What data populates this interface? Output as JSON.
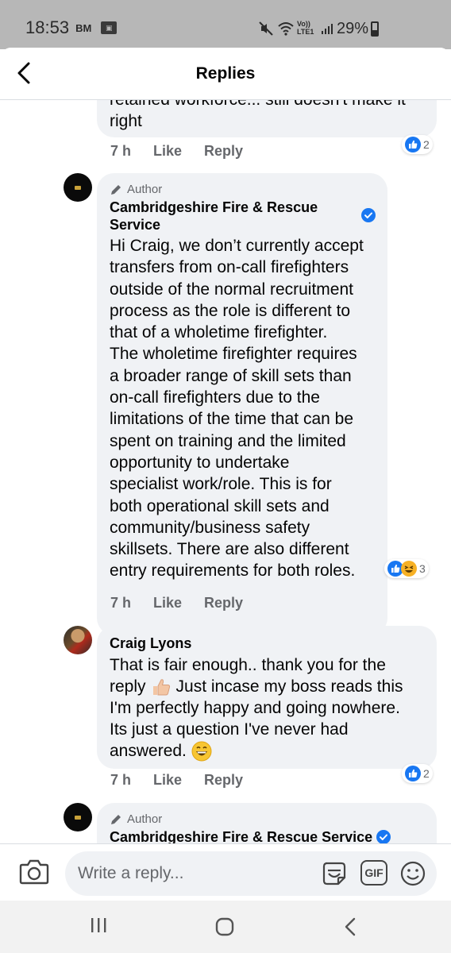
{
  "status_bar": {
    "time": "18:53",
    "carrier_badge": "BM",
    "volte": "Vo)) LTE1",
    "battery": "29%"
  },
  "header": {
    "title": "Replies"
  },
  "comments": [
    {
      "partial_text_top": "retained workforce... still doesn't make it",
      "partial_text_bottom": "right",
      "time": "7 h",
      "like": "Like",
      "reply": "Reply",
      "reaction_count": "2",
      "reactions": [
        "like-icon"
      ]
    },
    {
      "author_tag": "Author",
      "name": "Cambridgeshire Fire & Rescue\nService",
      "verified": true,
      "text": "Hi Craig, we don’t currently accept\ntransfers from on-call firefighters\noutside of the normal recruitment\nprocess as the role is different to\nthat of a wholetime firefighter.\nThe wholetime firefighter requires\na broader range of skill sets than\non-call firefighters due to the\nlimitations of the time that can be\nspent on training and the limited\nopportunity to undertake\nspecialist work/role. This is for\nboth operational skill sets and\ncommunity/business safety\nskillsets. There are also different\nentry requirements for both roles.",
      "time": "7 h",
      "like": "Like",
      "reply": "Reply",
      "reaction_count": "3",
      "reactions": [
        "like-icon",
        "laughing-icon"
      ]
    },
    {
      "name": "Craig Lyons",
      "text_line1": "That is fair enough.. thank you for the",
      "text_line2_a": "reply",
      "text_line2_b": "Just incase my boss reads this",
      "text_line3": "I'm perfectly happy and going nowhere.",
      "text_line4": "Its just a question I've never had",
      "text_line5": "answered.",
      "time": "7 h",
      "like": "Like",
      "reply": "Reply",
      "reaction_count": "2",
      "reactions": [
        "like-icon"
      ]
    },
    {
      "author_tag": "Author",
      "name": "Cambridgeshire Fire & Rescue Service",
      "verified": true
    }
  ],
  "composer": {
    "placeholder": "Write a reply...",
    "gif_label": "GIF"
  },
  "colors": {
    "bubble": "#f0f2f5",
    "meta_text": "#65676b",
    "facebook_blue": "#1877f2",
    "status_bar": "#b7b7b7"
  }
}
